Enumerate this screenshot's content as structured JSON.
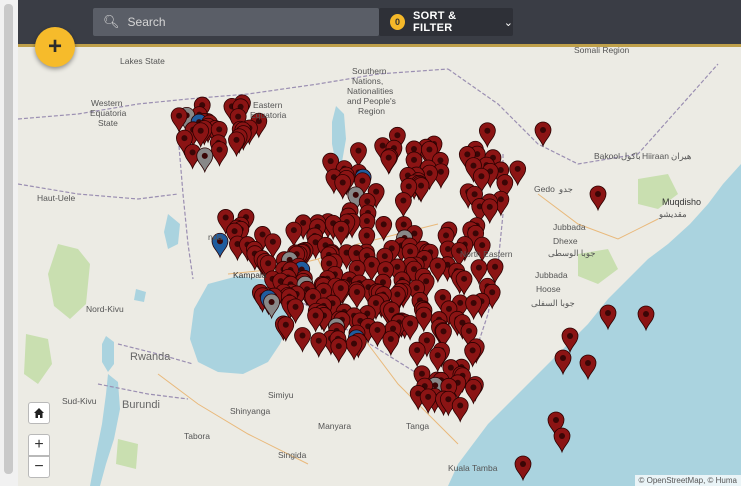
{
  "header": {
    "search_placeholder": "Search",
    "filter_count": "0",
    "filter_label": "SORT & FILTER"
  },
  "fab": {
    "label": "+"
  },
  "controls": {
    "zoom_in": "+",
    "zoom_out": "−"
  },
  "map": {
    "attribution": "© OpenStreetMap, © Huma",
    "colors": {
      "land": "#ecebe4",
      "water": "#aad3df",
      "park": "#c9dfb0",
      "marker": "#8b1414",
      "marker_grey": "#888888",
      "marker_blue": "#1f5c9e"
    },
    "labels": [
      {
        "text": "Lakes State"
      },
      {
        "text": "Western"
      },
      {
        "text": "Equatoria"
      },
      {
        "text": "State"
      },
      {
        "text": "Eastern"
      },
      {
        "text": "Equatoria"
      },
      {
        "text": "Southern"
      },
      {
        "text": "Nations,"
      },
      {
        "text": "Nationalities"
      },
      {
        "text": "and People's"
      },
      {
        "text": "Region"
      },
      {
        "text": "Somali Region"
      },
      {
        "text": "Bakool"
      },
      {
        "text": "باكول"
      },
      {
        "text": "Hiiraan"
      },
      {
        "text": "هيران"
      },
      {
        "text": "Gedo"
      },
      {
        "text": "جدو"
      },
      {
        "text": "Muqdisho"
      },
      {
        "text": "مقديشو"
      },
      {
        "text": "Jubbada"
      },
      {
        "text": "Dhexe"
      },
      {
        "text": "جوبا الوسطى"
      },
      {
        "text": "North Eastern"
      },
      {
        "text": "Jubbada"
      },
      {
        "text": "Hoose"
      },
      {
        "text": "جوبا السفلى"
      },
      {
        "text": "Haut-Uele"
      },
      {
        "text": "Kampala"
      },
      {
        "text": "Nord-Kivu"
      },
      {
        "text": "Rwanda"
      },
      {
        "text": "Burundi"
      },
      {
        "text": "Sud-Kivu"
      },
      {
        "text": "Simiyu"
      },
      {
        "text": "Shinyanga"
      },
      {
        "text": "Manyara"
      },
      {
        "text": "Tanga"
      },
      {
        "text": "Tabora"
      },
      {
        "text": "Singida"
      },
      {
        "text": "Kuala Tamba"
      },
      {
        "text": "nda"
      }
    ],
    "icons": {
      "search": "search-icon",
      "chevron": "chevron-down-icon",
      "home": "home-icon",
      "marker": "map-marker-icon"
    }
  }
}
